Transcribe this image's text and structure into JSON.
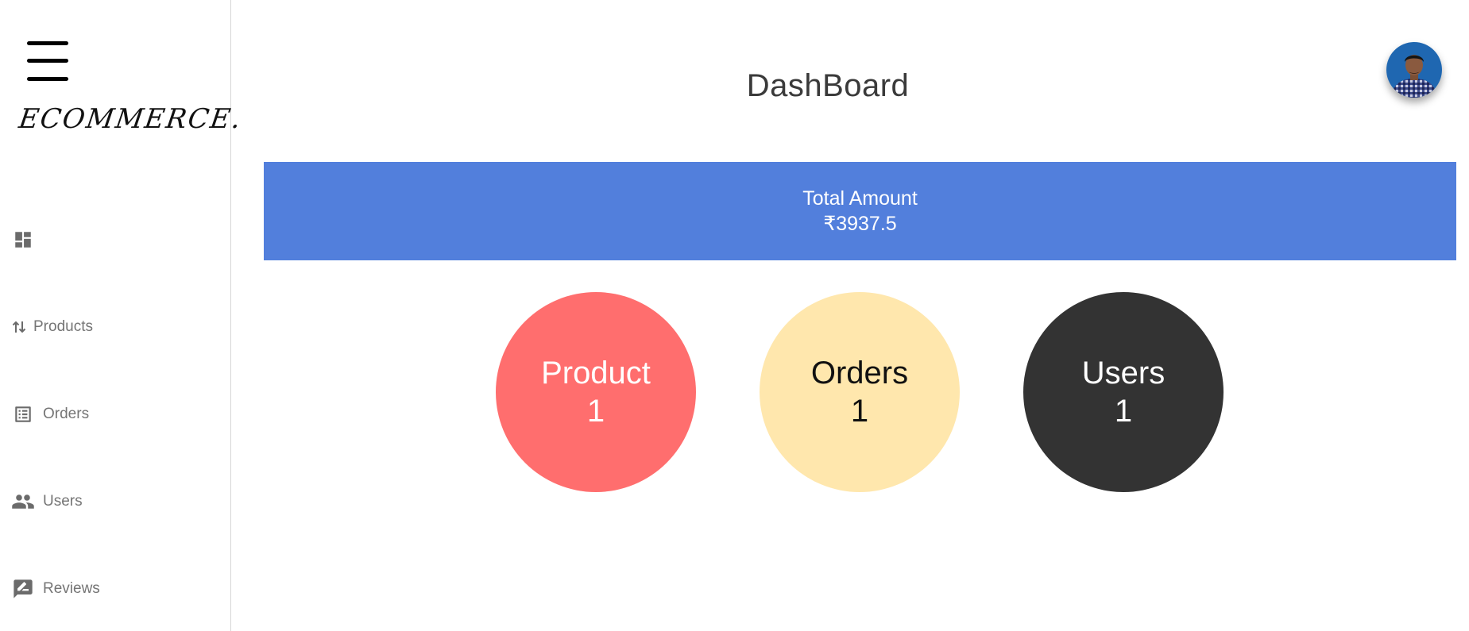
{
  "sidebar": {
    "logo": "ECOMMERCE.",
    "items": [
      {
        "label": "",
        "icon": "dashboard-icon"
      },
      {
        "label": "Products",
        "icon": "swap-vertical-icon"
      },
      {
        "label": "Orders",
        "icon": "list-alt-icon"
      },
      {
        "label": "Users",
        "icon": "people-icon"
      },
      {
        "label": "Reviews",
        "icon": "rate-review-icon"
      }
    ]
  },
  "header": {
    "title": "DashBoard"
  },
  "summary": {
    "label": "Total Amount",
    "value": "₹3937.5"
  },
  "stats": [
    {
      "label": "Product",
      "value": "1",
      "color": "#ff6e6e"
    },
    {
      "label": "Orders",
      "value": "1",
      "color": "#ffe7ad"
    },
    {
      "label": "Users",
      "value": "1",
      "color": "#333333"
    }
  ],
  "colors": {
    "banner": "#527fdc",
    "sidebar_text": "#757575"
  }
}
